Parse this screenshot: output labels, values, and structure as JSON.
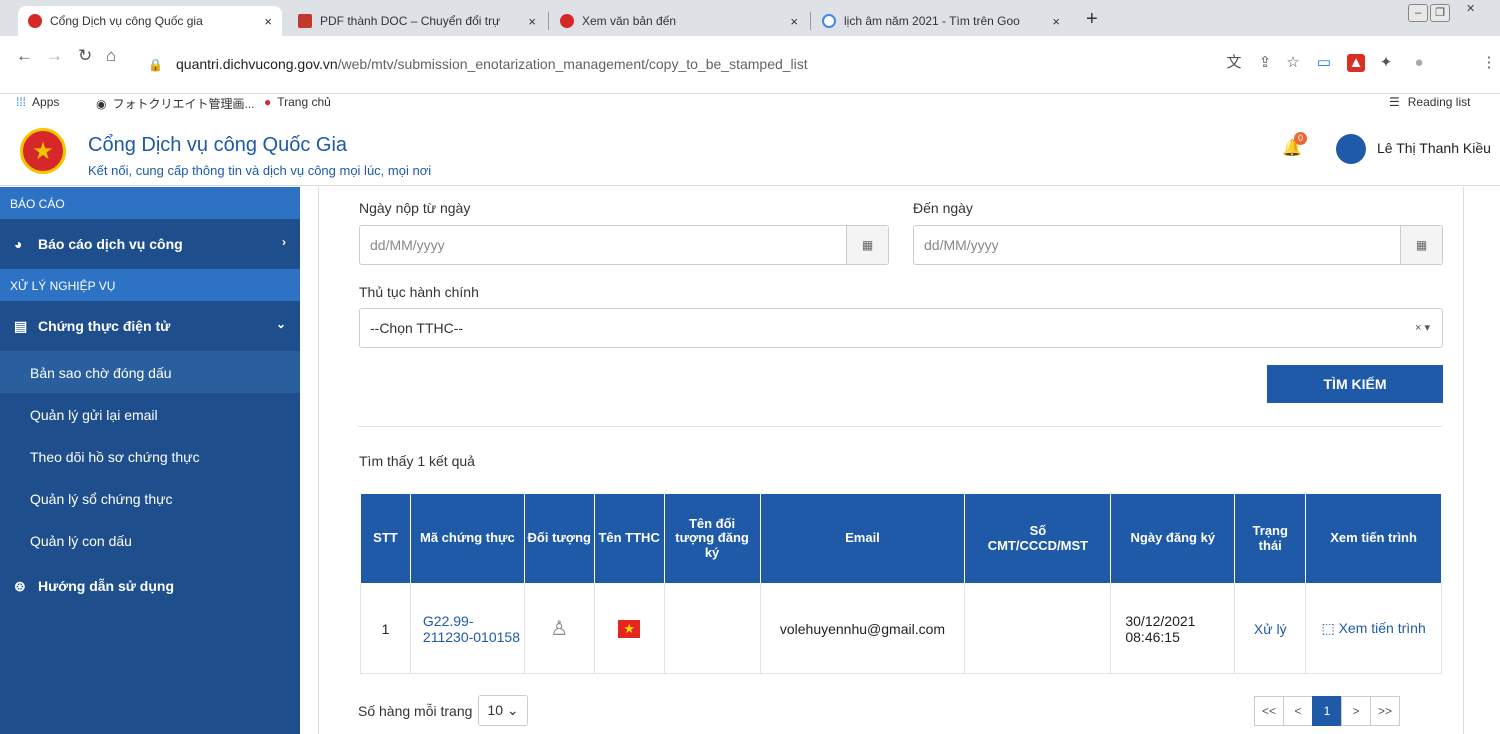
{
  "browser": {
    "tabs": [
      {
        "title": "Cổng Dịch vụ công Quốc gia",
        "close": "×"
      },
      {
        "title": "PDF thành DOC – Chuyển đổi trự",
        "close": "×"
      },
      {
        "title": "Xem văn bản đến",
        "close": "×"
      },
      {
        "title": "lịch âm năm 2021 - Tìm trên Goo",
        "close": "×"
      }
    ],
    "newtab": "+",
    "url_host": "quantri.dichvucong.gov.vn",
    "url_path": "/web/mtv/submission_enotarization_management/copy_to_be_stamped_list",
    "bookmarks": [
      "Apps",
      "フォトクリエイト管理画...",
      "Trang chủ"
    ],
    "reading_list": "Reading list"
  },
  "header": {
    "brand": "Cổng Dịch vụ công Quốc Gia",
    "slogan": "Kết nối, cung cấp thông tin và dịch vụ công mọi lúc, mọi nơi",
    "notif_count": "0",
    "user": "Lê Thị Thanh Kiều"
  },
  "sidebar": {
    "sec1": "BÁO CÁO",
    "item_report": "Báo cáo dịch vụ công",
    "sec2": "XỬ LÝ NGHIỆP VỤ",
    "item_cert": "Chứng thực điện tử",
    "sub": [
      "Bản sao chờ đóng dấu",
      "Quản lý gửi lại email",
      "Theo dõi hồ sơ chứng thực",
      "Quản lý sổ chứng thực",
      "Quản lý con dấu"
    ],
    "item_help": "Hướng dẫn sử dụng"
  },
  "form": {
    "from_label": "Ngày nộp từ ngày",
    "from_placeholder": "dd/MM/yyyy",
    "to_label": "Đến ngày",
    "to_placeholder": "dd/MM/yyyy",
    "proc_label": "Thủ tục hành chính",
    "proc_value": "--Chọn TTHC--",
    "search_btn": "TÌM KIẾM"
  },
  "result_text": "Tìm thấy 1 kết quả",
  "table": {
    "headers": [
      "STT",
      "Mã chứng thực",
      "Đối tượng",
      "Tên TTHC",
      "Tên đối tượng đăng ký",
      "Email",
      "Số CMT/CCCD/MST",
      "Ngày đăng ký",
      "Trạng thái",
      "Xem tiến trình"
    ],
    "row": {
      "stt": "1",
      "code": "G22.99-211230-010158",
      "email": "volehuyennhu@gmail.com",
      "date": "30/12/2021 08:46:15",
      "status": "Xử lý",
      "progress": "Xem tiến trình"
    }
  },
  "paging": {
    "label": "Số hàng mỗi trang",
    "size": "10",
    "first": "<<",
    "prev": "<",
    "current": "1",
    "next": ">",
    "last": ">>"
  }
}
